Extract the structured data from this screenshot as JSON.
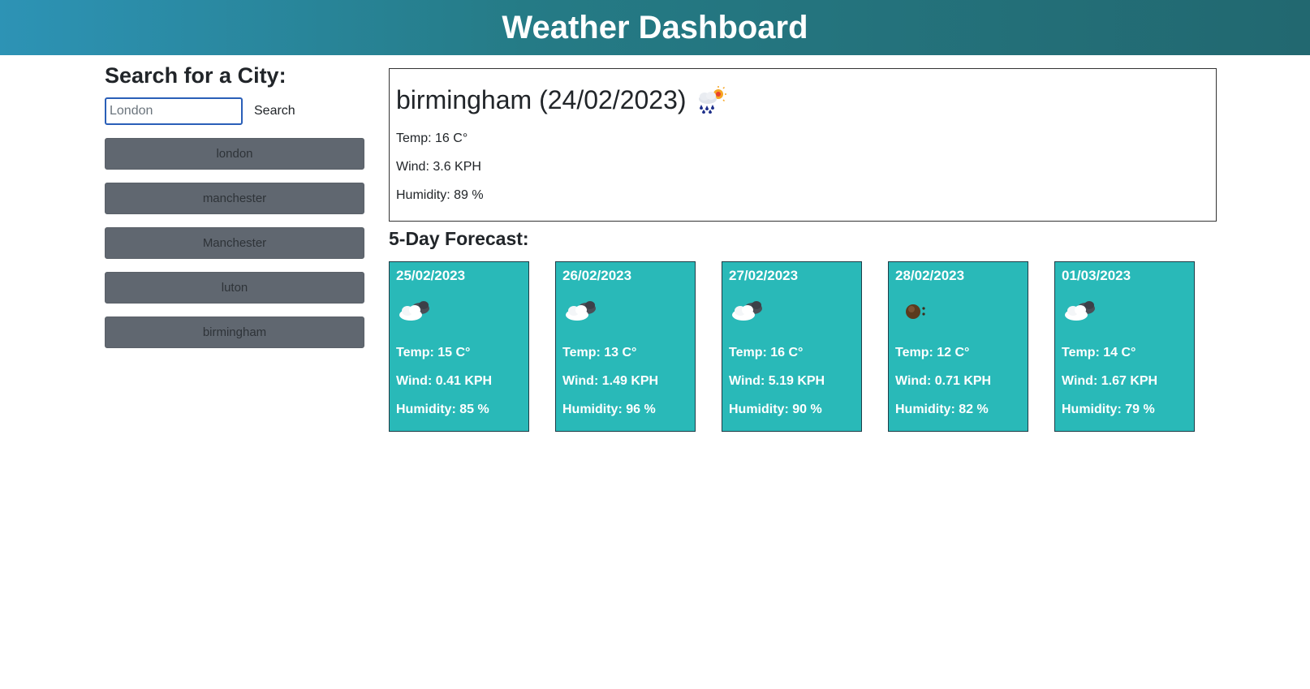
{
  "header": {
    "title": "Weather Dashboard"
  },
  "sidebar": {
    "heading": "Search for a City:",
    "search": {
      "placeholder": "London",
      "value": "",
      "button_label": "Search"
    },
    "history": [
      "london",
      "manchester",
      "Manchester",
      "luton",
      "birmingham"
    ]
  },
  "current": {
    "title": "birmingham (24/02/2023)",
    "icon": "rain-sun-icon",
    "temp": "Temp: 16 C°",
    "wind": "Wind: 3.6 KPH",
    "humidity": "Humidity: 89 %"
  },
  "forecast": {
    "heading": "5-Day Forecast:",
    "days": [
      {
        "date": "25/02/2023",
        "icon": "cloudy-icon",
        "temp": "Temp: 15 C°",
        "wind": "Wind: 0.41 KPH",
        "humidity": "Humidity: 85 %"
      },
      {
        "date": "26/02/2023",
        "icon": "cloudy-icon",
        "temp": "Temp: 13 C°",
        "wind": "Wind: 1.49 KPH",
        "humidity": "Humidity: 96 %"
      },
      {
        "date": "27/02/2023",
        "icon": "cloudy-icon",
        "temp": "Temp: 16 C°",
        "wind": "Wind: 5.19 KPH",
        "humidity": "Humidity: 90 %"
      },
      {
        "date": "28/02/2023",
        "icon": "overcast-icon",
        "temp": "Temp: 12 C°",
        "wind": "Wind: 0.71 KPH",
        "humidity": "Humidity: 82 %"
      },
      {
        "date": "01/03/2023",
        "icon": "cloudy-icon",
        "temp": "Temp: 14 C°",
        "wind": "Wind: 1.67 KPH",
        "humidity": "Humidity: 79 %"
      }
    ]
  },
  "colors": {
    "header_start": "#2d93b5",
    "header_end": "#226870",
    "card_bg": "#29b9b8",
    "history_button_bg": "#606770"
  }
}
